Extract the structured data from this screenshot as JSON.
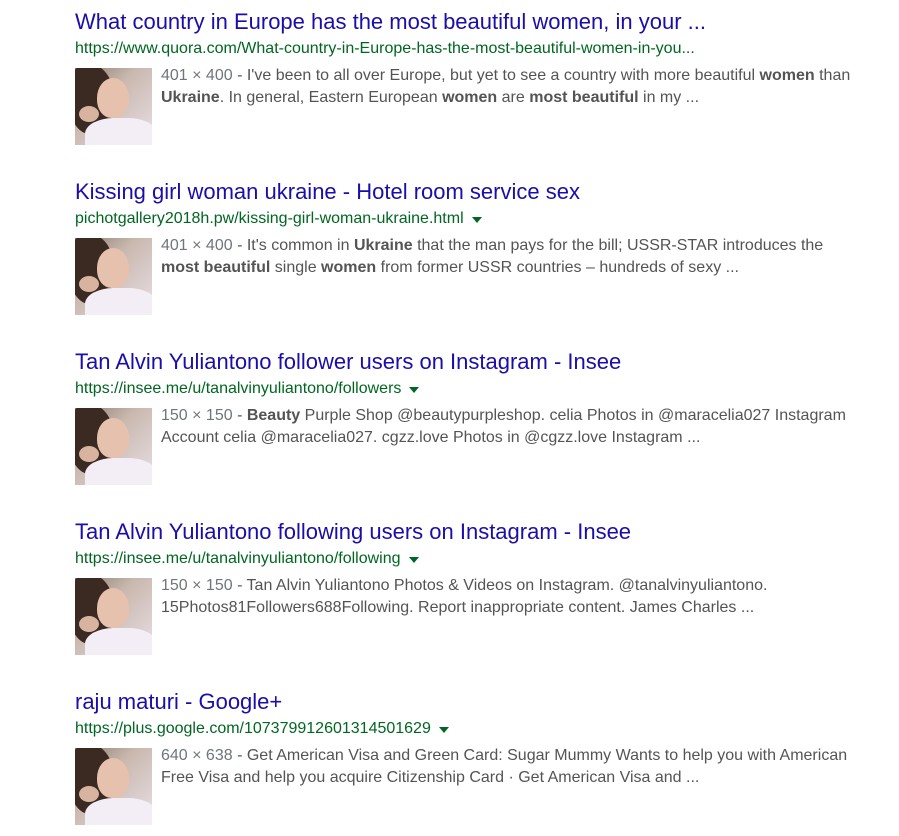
{
  "results": [
    {
      "title": "What country in Europe has the most beautiful women, in your ...",
      "url": "https://www.quora.com/What-country-in-Europe-has-the-most-beautiful-women-in-you...",
      "has_dropdown": false,
      "dims": "401 × 400",
      "snippet_parts": [
        {
          "t": " - I've been to all over Europe, but yet to see a country with more beautiful ",
          "b": false
        },
        {
          "t": "women",
          "b": true
        },
        {
          "t": " than ",
          "b": false
        },
        {
          "t": "Ukraine",
          "b": true
        },
        {
          "t": ". In general, Eastern European ",
          "b": false
        },
        {
          "t": "women",
          "b": true
        },
        {
          "t": " are ",
          "b": false
        },
        {
          "t": "most beautiful",
          "b": true
        },
        {
          "t": " in my ...",
          "b": false
        }
      ]
    },
    {
      "title": "Kissing girl woman ukraine - Hotel room service sex",
      "url": "pichotgallery2018h.pw/kissing-girl-woman-ukraine.html",
      "has_dropdown": true,
      "dims": "401 × 400",
      "snippet_parts": [
        {
          "t": " - It's common in ",
          "b": false
        },
        {
          "t": "Ukraine",
          "b": true
        },
        {
          "t": " that the man pays for the bill; USSR-STAR introduces the ",
          "b": false
        },
        {
          "t": "most beautiful",
          "b": true
        },
        {
          "t": " single ",
          "b": false
        },
        {
          "t": "women",
          "b": true
        },
        {
          "t": " from former USSR countries – hundreds of sexy ...",
          "b": false
        }
      ]
    },
    {
      "title": "Tan Alvin Yuliantono follower users on Instagram - Insee",
      "url": "https://insee.me/u/tanalvinyuliantono/followers",
      "has_dropdown": true,
      "dims": "150 × 150",
      "snippet_parts": [
        {
          "t": " - ",
          "b": false
        },
        {
          "t": "Beauty",
          "b": true
        },
        {
          "t": " Purple Shop @beautypurpleshop. celia Photos in @maracelia027 Instagram Account celia @maracelia027. cgzz.love Photos in @cgzz.love Instagram ...",
          "b": false
        }
      ]
    },
    {
      "title": "Tan Alvin Yuliantono following users on Instagram - Insee",
      "url": "https://insee.me/u/tanalvinyuliantono/following",
      "has_dropdown": true,
      "dims": "150 × 150",
      "snippet_parts": [
        {
          "t": " - Tan Alvin Yuliantono Photos & Videos on Instagram. @tanalvinyuliantono. 15Photos81Followers688Following. Report inappropriate content. James Charles ...",
          "b": false
        }
      ]
    },
    {
      "title": "raju maturi - Google+",
      "url": "https://plus.google.com/107379912601314501629",
      "has_dropdown": true,
      "dims": "640 × 638",
      "snippet_parts": [
        {
          "t": " - Get American Visa and Green Card: Sugar Mummy Wants to help you with American Free Visa and help you acquire Citizenship Card · Get American Visa and ...",
          "b": false
        }
      ]
    }
  ]
}
